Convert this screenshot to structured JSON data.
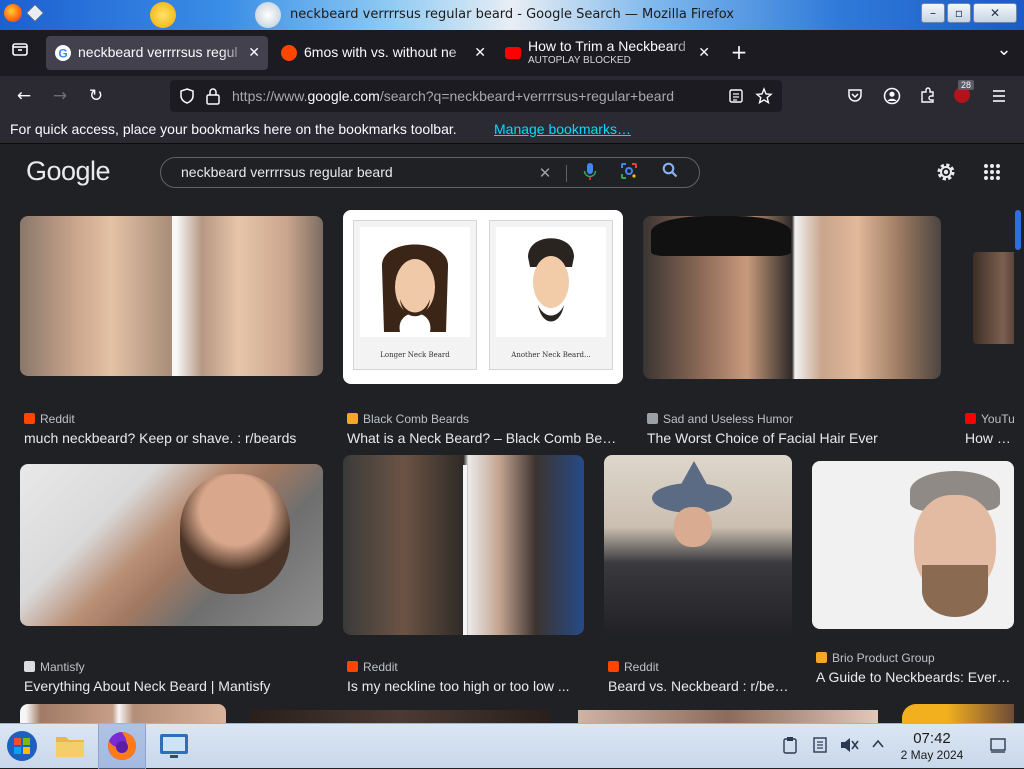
{
  "window": {
    "title": "neckbeard verrrrsus regular beard - Google Search — Mozilla Firefox",
    "minimize": "–",
    "maximize": "▫",
    "close": "✕"
  },
  "tabs": [
    {
      "label": "neckbeard verrrrsus regul",
      "sub": "",
      "close": "✕",
      "active": true
    },
    {
      "label": "6mos with vs. without ne",
      "sub": "",
      "close": "✕",
      "active": false
    },
    {
      "label": "How to Trim a Neckbeard",
      "sub": "AUTOPLAY BLOCKED",
      "close": "✕",
      "active": false
    }
  ],
  "tabstrip": {
    "new_tab": "+",
    "list_all": "⌄"
  },
  "nav": {
    "back": "←",
    "forward": "→",
    "reload": "↻",
    "url_prefix": "https://www.",
    "url_domain": "google.com",
    "url_rest": "/search?q=neckbeard+verrrrsus+regular+beard",
    "extension_badge": "28"
  },
  "bookmarks": {
    "text": "For quick access, place your bookmarks here on the bookmarks toolbar.",
    "link": "Manage bookmarks…"
  },
  "google": {
    "logo": "Google",
    "query": "neckbeard verrrrsus regular beard",
    "clear": "✕"
  },
  "results": [
    {
      "source": "Reddit",
      "title": "much neckbeard? Keep or shave. : r/beards",
      "favicon": "#ff4500"
    },
    {
      "source": "Black Comb Beards",
      "title": "What is a Neck Beard? – Black Comb Beards",
      "favicon": "#f5a623"
    },
    {
      "source": "Sad and Useless Humor",
      "title": "The Worst Choice of Facial Hair Ever",
      "favicon": "#9aa0a6"
    },
    {
      "source": "YouTube",
      "title": "How to Trim a Neckbeard",
      "favicon": "#ff0000"
    },
    {
      "source": "Mantisfy",
      "title": "Everything About Neck Beard | Mantisfy",
      "favicon": "#dadce0"
    },
    {
      "source": "Reddit",
      "title": "Is my neckline too high or too low ...",
      "favicon": "#ff4500"
    },
    {
      "source": "Reddit",
      "title": "Beard vs. Neckbeard : r/beards",
      "favicon": "#ff4500"
    },
    {
      "source": "Brio Product Group",
      "title": "A Guide to Neckbeards: Everything",
      "favicon": "#f5a623"
    }
  ],
  "image_captions": {
    "left": "Longer Neck Beard",
    "right": "Another Neck Beard..."
  },
  "taskbar": {
    "time": "07:42",
    "date": "2 May 2024"
  },
  "colors": {
    "accent": "#00ddff",
    "google_bg": "#202124",
    "tab_active": "#42414d"
  }
}
